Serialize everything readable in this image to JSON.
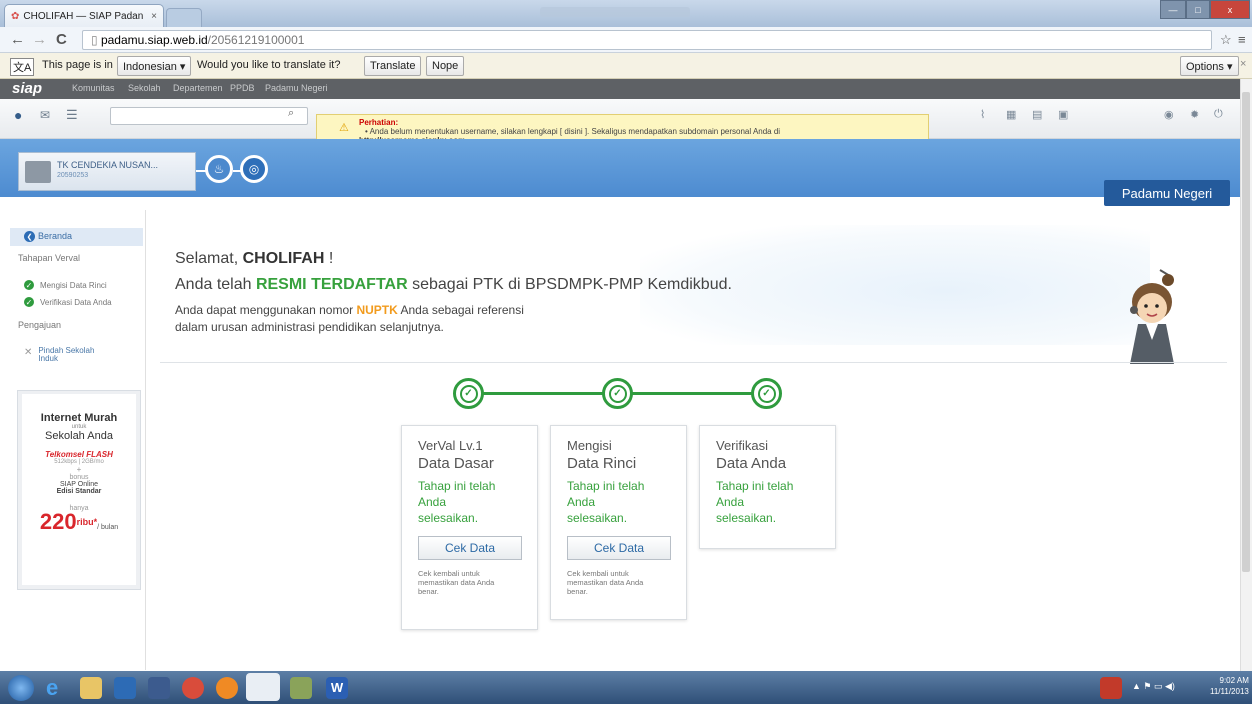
{
  "browser": {
    "tab_title": "CHOLIFAH — SIAP Padan",
    "tab_close": "×",
    "url_domain": "padamu.siap.web.id",
    "url_path": "/20561219100001",
    "window_min": "—",
    "window_max": "□",
    "window_close": "x"
  },
  "translate_bar": {
    "text_prefix": "This page is in",
    "language": "Indonesian ▾",
    "question": "Would you like to translate it?",
    "translate_btn": "Translate",
    "nope_btn": "Nope",
    "options_btn": "Options ▾",
    "close": "×"
  },
  "site_nav": {
    "logo": "siap",
    "items": [
      "Komunitas",
      "Sekolah",
      "Departemen",
      "PPDB",
      "Padamu Negeri"
    ]
  },
  "alert": {
    "title": "Perhatian:",
    "line1": "Anda belum menentukan username, silakan lengkapi [ disini ]. Sekaligus mendapatkan subdomain personal Anda di",
    "line2": "http://username.siapku.com."
  },
  "school": {
    "name": "TK CENDEKIA NUSAN...",
    "code": "20590253"
  },
  "banner": {
    "padamu_label": "Padamu Negeri"
  },
  "sidebar": {
    "beranda": "Beranda",
    "tahapan_verval": "Tahapan Verval",
    "mengisi_data_rinci": "Mengisi Data Rinci",
    "verifikasi_data_anda": "Verifikasi Data Anda",
    "pengajuan": "Pengajuan",
    "pindah_sekolah": "Pindah Sekolah Induk"
  },
  "ad": {
    "title1": "Internet Murah",
    "untuk": "untuk",
    "title2": "Sekolah Anda",
    "brand1": "Telkomsel",
    "brand2": "FLASH",
    "spec1": "512kbps",
    "spec2": "2GB/mo",
    "plus": "+",
    "bonus": "bonus",
    "siap_online": "SIAP Online",
    "edisi": "Edisi Standar",
    "hanya": "hanya",
    "price": "220",
    "price_unit": "ribu*",
    "per": "/ bulan"
  },
  "main": {
    "greet_prefix": "Selamat, ",
    "greet_name": "CHOLIFAH",
    "greet_suffix": " !",
    "resmi_prefix": "Anda telah ",
    "resmi_bold": "RESMI TERDAFTAR",
    "resmi_suffix": " sebagai PTK di BPSDMPK-PMP Kemdikbud.",
    "nuptk_prefix": "Anda dapat menggunakan nomor ",
    "nuptk_bold": "NUPTK",
    "nuptk_suffix": " Anda sebagai referensi",
    "nuptk_line2": "dalam urusan administrasi pendidikan selanjutnya."
  },
  "steps": [
    {
      "h1": "VerVal Lv.1",
      "h2": "Data Dasar",
      "status1": "Tahap ini telah",
      "status2": "Anda",
      "status3": "selesaikan.",
      "button": "Cek Data",
      "note": "Cek kembali untuk memastikan data Anda benar."
    },
    {
      "h1": "Mengisi",
      "h2": "Data Rinci",
      "status1": "Tahap ini telah",
      "status2": "Anda",
      "status3": "selesaikan.",
      "button": "Cek Data",
      "note": "Cek kembali untuk memastikan data Anda benar."
    },
    {
      "h1": "Verifikasi",
      "h2": "Data Anda",
      "status1": "Tahap ini telah",
      "status2": "Anda",
      "status3": "selesaikan."
    }
  ],
  "taskbar": {
    "time": "9:02 AM",
    "date": "11/11/2013"
  },
  "colors": {
    "green": "#37a13d",
    "orange": "#f29b1d",
    "banner_blue": "#4d8bd0"
  }
}
